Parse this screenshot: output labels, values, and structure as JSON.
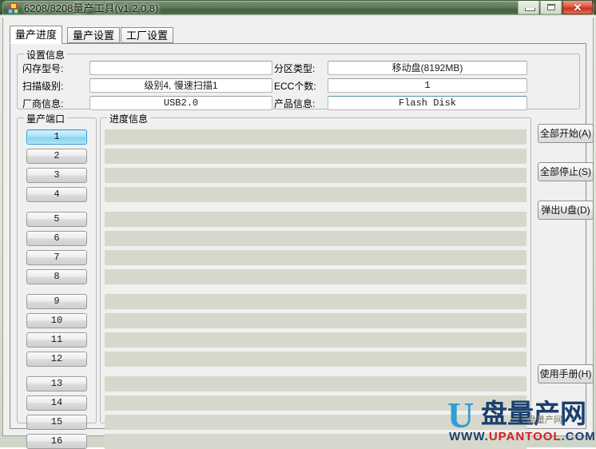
{
  "window": {
    "title": "6208/8208量产工具(v1.2.0.8)",
    "icon": "app-icon",
    "controls": {
      "minimize": "minimize-icon",
      "maximize": "maximize-icon",
      "close": "✕"
    }
  },
  "tabs": [
    {
      "label": "量产进度",
      "active": true
    },
    {
      "label": "量产设置",
      "active": false
    },
    {
      "label": "工厂设置",
      "active": false
    }
  ],
  "settings": {
    "group_label": "设置信息",
    "fields": [
      {
        "label": "闪存型号:",
        "value": "",
        "mono": true
      },
      {
        "label": "扫描级别:",
        "value": "级别4, 慢速扫描1",
        "mono": false
      },
      {
        "label": "厂商信息:",
        "value": "USB2.0",
        "mono": true
      },
      {
        "label": "分区类型:",
        "value": "移动盘(8192MB)",
        "mono": false
      },
      {
        "label": "ECC个数:",
        "value": "1",
        "mono": true
      },
      {
        "label": "产品信息:",
        "value": "Flash Disk",
        "mono": true
      }
    ]
  },
  "ports": {
    "group_label": "量产端口",
    "selected": 1,
    "items": [
      {
        "label": "1"
      },
      {
        "label": "2"
      },
      {
        "label": "3"
      },
      {
        "label": "4"
      },
      {
        "label": "5"
      },
      {
        "label": "6"
      },
      {
        "label": "7"
      },
      {
        "label": "8"
      },
      {
        "label": "9"
      },
      {
        "label": "10"
      },
      {
        "label": "11"
      },
      {
        "label": "12"
      },
      {
        "label": "13"
      },
      {
        "label": "14"
      },
      {
        "label": "15"
      },
      {
        "label": "16"
      }
    ]
  },
  "progress": {
    "group_label": "进度信息",
    "rows": [
      {
        "text": ""
      },
      {
        "text": ""
      },
      {
        "text": ""
      },
      {
        "text": ""
      },
      {
        "text": ""
      },
      {
        "text": ""
      },
      {
        "text": ""
      },
      {
        "text": ""
      },
      {
        "text": ""
      },
      {
        "text": ""
      },
      {
        "text": ""
      },
      {
        "text": ""
      },
      {
        "text": ""
      },
      {
        "text": ""
      },
      {
        "text": ""
      },
      {
        "text": ""
      }
    ]
  },
  "actions": [
    {
      "label": "全部开始(A)",
      "name": "start-all-button"
    },
    {
      "label": "全部停止(S)",
      "name": "stop-all-button"
    },
    {
      "label": "弹出U盘(D)",
      "name": "eject-usb-button"
    },
    {
      "label": "使用手册(H)",
      "name": "user-manual-button"
    }
  ],
  "watermark": {
    "letter": "U",
    "chinese": "盘量产网",
    "url_prefix": "WWW.",
    "url_main": "UPANTOOL",
    "url_suffix": ".COM",
    "ghost": "盘量产网"
  },
  "colors": {
    "accent_selected": "#85d3f0",
    "progress_bar": "#d6d8cb",
    "title_green": "#3f5d38",
    "close_red": "#c6351f",
    "watermark_blue": "#2f9ed4",
    "watermark_navy": "#1b3f6e",
    "watermark_red": "#cf1f26"
  }
}
